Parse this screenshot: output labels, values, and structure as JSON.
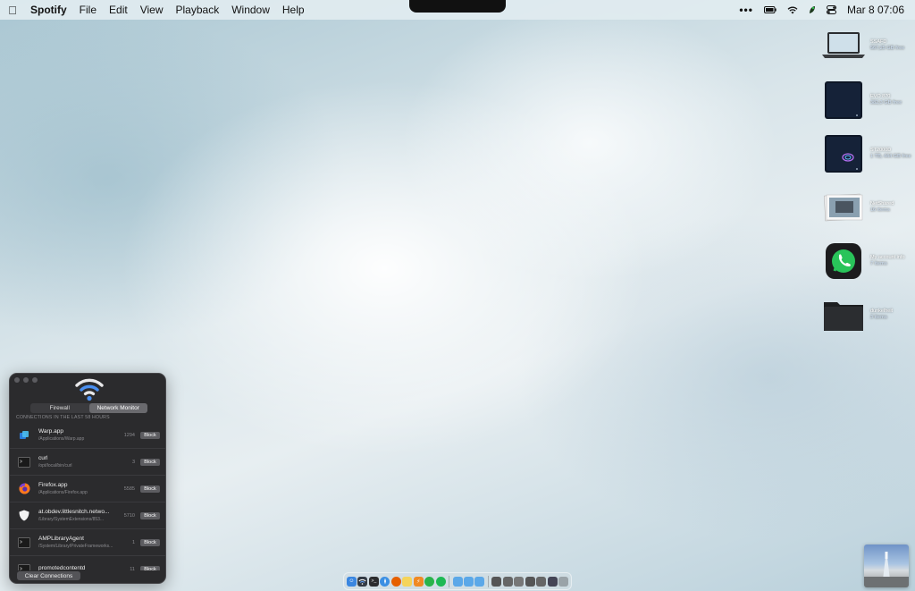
{
  "menubar": {
    "app_name": "Spotify",
    "items": [
      "File",
      "Edit",
      "View",
      "Playback",
      "Window",
      "Help"
    ],
    "clock": "Mar 8  07:06",
    "icons": [
      "more-icon",
      "battery-icon",
      "wifi-icon",
      "leaf-icon",
      "control-center-icon"
    ]
  },
  "desktop": {
    "items": [
      {
        "name": "SSAFD",
        "sub": "567,25 GB free",
        "icon": "laptop-icon"
      },
      {
        "name": "EVO 870",
        "sub": "382,3 GB free",
        "icon": "external-drive-icon"
      },
      {
        "name": "ST2000D",
        "sub": "1 TB, 444 GB free",
        "icon": "external-drive-icon"
      },
      {
        "name": "NetShared",
        "sub": "16 items",
        "icon": "photo-stack-icon"
      },
      {
        "name": "My account info",
        "sub": "7 items",
        "icon": "whatsapp-icon"
      },
      {
        "name": "dunkelheit",
        "sub": "3 items",
        "icon": "folder-icon"
      }
    ]
  },
  "little_snitch": {
    "tabs": [
      "Firewall",
      "Network Monitor"
    ],
    "active_tab": "Network Monitor",
    "header": "CONNECTIONS IN THE LAST 58 HOURS",
    "block_label": "Block",
    "clear_label": "Clear Connections",
    "rows": [
      {
        "name": "Warp.app",
        "path": "/Applications/Warp.app",
        "count": "1294",
        "icon": "warp-icon"
      },
      {
        "name": "curl",
        "path": "/opt/local/bin/curl",
        "count": "3",
        "icon": "terminal-icon"
      },
      {
        "name": "Firefox.app",
        "path": "/Applications/Firefox.app",
        "count": "5585",
        "icon": "firefox-icon"
      },
      {
        "name": "at.obdev.littlesnitch.netwo...",
        "path": "/Library/SystemExtensions/853...",
        "count": "5710",
        "icon": "shield-icon"
      },
      {
        "name": "AMPLibraryAgent",
        "path": "/System/Library/PrivateFrameworks...",
        "count": "1",
        "icon": "terminal-icon"
      },
      {
        "name": "promotedcontentd",
        "path": "",
        "count": "11",
        "icon": "terminal-icon"
      }
    ]
  },
  "dock": {
    "apps": [
      {
        "icon": "finder-icon",
        "color": "#3a86e0"
      },
      {
        "icon": "little-snitch-icon",
        "color": "#333a44"
      },
      {
        "icon": "terminal-icon",
        "color": "#2c2c2e"
      },
      {
        "icon": "safari-icon",
        "color": "#3b8fe3"
      },
      {
        "icon": "firefox-icon",
        "color": "#e66000"
      },
      {
        "icon": "notes-icon",
        "color": "#f5d45a"
      },
      {
        "icon": "reeder-icon",
        "color": "#f08a24"
      },
      {
        "icon": "whatsapp-icon",
        "color": "#29b34a"
      },
      {
        "icon": "spotify-icon",
        "color": "#1db954"
      }
    ],
    "docs": [
      {
        "icon": "folder-icon",
        "color": "#5ba8e8"
      },
      {
        "icon": "folder-icon",
        "color": "#5ba8e8"
      },
      {
        "icon": "folder-icon",
        "color": "#5ba8e8"
      },
      {
        "icon": "window-icon",
        "color": "#555"
      },
      {
        "icon": "window-icon",
        "color": "#666"
      },
      {
        "icon": "window-icon",
        "color": "#777"
      },
      {
        "icon": "window-icon",
        "color": "#555"
      },
      {
        "icon": "window-icon",
        "color": "#666"
      },
      {
        "icon": "window-icon",
        "color": "#445"
      },
      {
        "icon": "trash-icon",
        "color": "#9aa3a8"
      }
    ]
  }
}
